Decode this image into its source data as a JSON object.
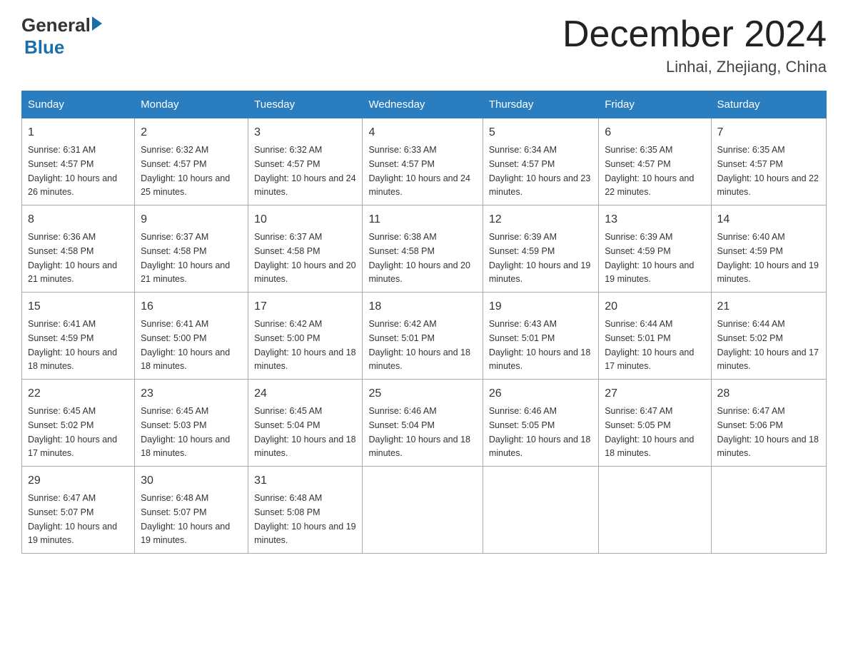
{
  "header": {
    "logo_general": "General",
    "logo_blue": "Blue",
    "title": "December 2024",
    "subtitle": "Linhai, Zhejiang, China"
  },
  "days_of_week": [
    "Sunday",
    "Monday",
    "Tuesday",
    "Wednesday",
    "Thursday",
    "Friday",
    "Saturday"
  ],
  "weeks": [
    [
      {
        "day": "1",
        "sunrise": "6:31 AM",
        "sunset": "4:57 PM",
        "daylight": "10 hours and 26 minutes."
      },
      {
        "day": "2",
        "sunrise": "6:32 AM",
        "sunset": "4:57 PM",
        "daylight": "10 hours and 25 minutes."
      },
      {
        "day": "3",
        "sunrise": "6:32 AM",
        "sunset": "4:57 PM",
        "daylight": "10 hours and 24 minutes."
      },
      {
        "day": "4",
        "sunrise": "6:33 AM",
        "sunset": "4:57 PM",
        "daylight": "10 hours and 24 minutes."
      },
      {
        "day": "5",
        "sunrise": "6:34 AM",
        "sunset": "4:57 PM",
        "daylight": "10 hours and 23 minutes."
      },
      {
        "day": "6",
        "sunrise": "6:35 AM",
        "sunset": "4:57 PM",
        "daylight": "10 hours and 22 minutes."
      },
      {
        "day": "7",
        "sunrise": "6:35 AM",
        "sunset": "4:57 PM",
        "daylight": "10 hours and 22 minutes."
      }
    ],
    [
      {
        "day": "8",
        "sunrise": "6:36 AM",
        "sunset": "4:58 PM",
        "daylight": "10 hours and 21 minutes."
      },
      {
        "day": "9",
        "sunrise": "6:37 AM",
        "sunset": "4:58 PM",
        "daylight": "10 hours and 21 minutes."
      },
      {
        "day": "10",
        "sunrise": "6:37 AM",
        "sunset": "4:58 PM",
        "daylight": "10 hours and 20 minutes."
      },
      {
        "day": "11",
        "sunrise": "6:38 AM",
        "sunset": "4:58 PM",
        "daylight": "10 hours and 20 minutes."
      },
      {
        "day": "12",
        "sunrise": "6:39 AM",
        "sunset": "4:59 PM",
        "daylight": "10 hours and 19 minutes."
      },
      {
        "day": "13",
        "sunrise": "6:39 AM",
        "sunset": "4:59 PM",
        "daylight": "10 hours and 19 minutes."
      },
      {
        "day": "14",
        "sunrise": "6:40 AM",
        "sunset": "4:59 PM",
        "daylight": "10 hours and 19 minutes."
      }
    ],
    [
      {
        "day": "15",
        "sunrise": "6:41 AM",
        "sunset": "4:59 PM",
        "daylight": "10 hours and 18 minutes."
      },
      {
        "day": "16",
        "sunrise": "6:41 AM",
        "sunset": "5:00 PM",
        "daylight": "10 hours and 18 minutes."
      },
      {
        "day": "17",
        "sunrise": "6:42 AM",
        "sunset": "5:00 PM",
        "daylight": "10 hours and 18 minutes."
      },
      {
        "day": "18",
        "sunrise": "6:42 AM",
        "sunset": "5:01 PM",
        "daylight": "10 hours and 18 minutes."
      },
      {
        "day": "19",
        "sunrise": "6:43 AM",
        "sunset": "5:01 PM",
        "daylight": "10 hours and 18 minutes."
      },
      {
        "day": "20",
        "sunrise": "6:44 AM",
        "sunset": "5:01 PM",
        "daylight": "10 hours and 17 minutes."
      },
      {
        "day": "21",
        "sunrise": "6:44 AM",
        "sunset": "5:02 PM",
        "daylight": "10 hours and 17 minutes."
      }
    ],
    [
      {
        "day": "22",
        "sunrise": "6:45 AM",
        "sunset": "5:02 PM",
        "daylight": "10 hours and 17 minutes."
      },
      {
        "day": "23",
        "sunrise": "6:45 AM",
        "sunset": "5:03 PM",
        "daylight": "10 hours and 18 minutes."
      },
      {
        "day": "24",
        "sunrise": "6:45 AM",
        "sunset": "5:04 PM",
        "daylight": "10 hours and 18 minutes."
      },
      {
        "day": "25",
        "sunrise": "6:46 AM",
        "sunset": "5:04 PM",
        "daylight": "10 hours and 18 minutes."
      },
      {
        "day": "26",
        "sunrise": "6:46 AM",
        "sunset": "5:05 PM",
        "daylight": "10 hours and 18 minutes."
      },
      {
        "day": "27",
        "sunrise": "6:47 AM",
        "sunset": "5:05 PM",
        "daylight": "10 hours and 18 minutes."
      },
      {
        "day": "28",
        "sunrise": "6:47 AM",
        "sunset": "5:06 PM",
        "daylight": "10 hours and 18 minutes."
      }
    ],
    [
      {
        "day": "29",
        "sunrise": "6:47 AM",
        "sunset": "5:07 PM",
        "daylight": "10 hours and 19 minutes."
      },
      {
        "day": "30",
        "sunrise": "6:48 AM",
        "sunset": "5:07 PM",
        "daylight": "10 hours and 19 minutes."
      },
      {
        "day": "31",
        "sunrise": "6:48 AM",
        "sunset": "5:08 PM",
        "daylight": "10 hours and 19 minutes."
      },
      null,
      null,
      null,
      null
    ]
  ]
}
